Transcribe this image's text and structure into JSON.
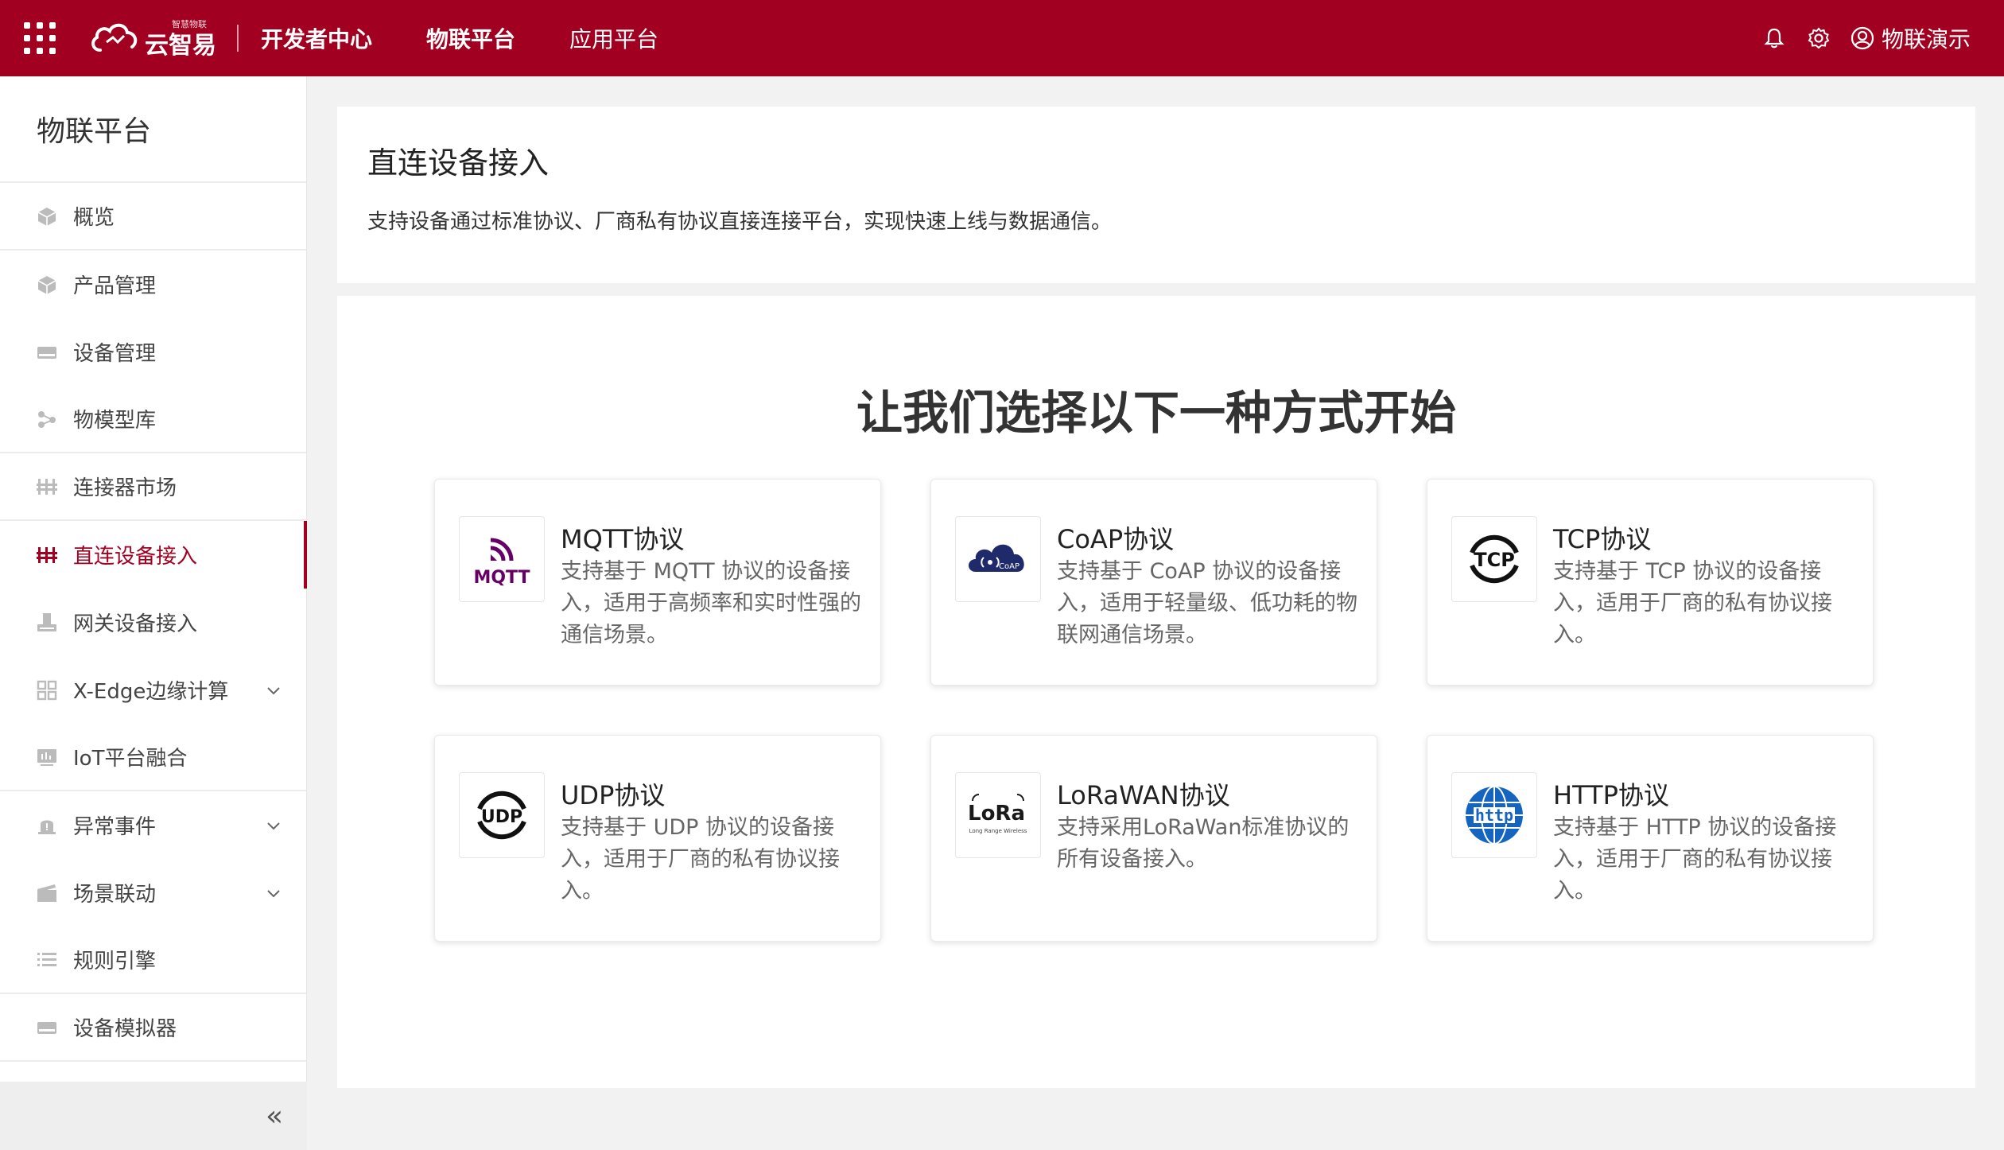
{
  "topbar": {
    "logo_small": "智慧物联",
    "logo_text": "云智易",
    "developer_center": "开发者中心",
    "nav": [
      "物联平台",
      "应用平台"
    ],
    "user_name": "物联演示",
    "icons": [
      "apps-grid-icon",
      "bell-icon",
      "gear-icon",
      "user-circle-icon"
    ]
  },
  "sidebar": {
    "title": "物联平台",
    "items": [
      {
        "label": "概览",
        "icon": "cube-icon"
      },
      {
        "label": "产品管理",
        "icon": "cube-icon"
      },
      {
        "label": "设备管理",
        "icon": "device-icon"
      },
      {
        "label": "物模型库",
        "icon": "nodes-icon"
      },
      {
        "label": "连接器市场",
        "icon": "connector-icon"
      },
      {
        "label": "直连设备接入",
        "icon": "connector-icon",
        "active": true
      },
      {
        "label": "网关设备接入",
        "icon": "gateway-icon"
      },
      {
        "label": "X-Edge边缘计算",
        "icon": "grid-icon",
        "expandable": true
      },
      {
        "label": "IoT平台融合",
        "icon": "monitor-icon"
      },
      {
        "label": "异常事件",
        "icon": "alert-icon",
        "expandable": true
      },
      {
        "label": "场景联动",
        "icon": "scene-icon",
        "expandable": true
      },
      {
        "label": "规则引擎",
        "icon": "list-icon"
      },
      {
        "label": "设备模拟器",
        "icon": "device-icon"
      }
    ],
    "collapse_label": "«"
  },
  "header": {
    "title": "直连设备接入",
    "description": "支持设备通过标准协议、厂商私有协议直接连接平台，实现快速上线与数据通信。"
  },
  "main": {
    "headline": "让我们选择以下一种方式开始",
    "protocols": [
      {
        "name": "MQTT协议",
        "description": "支持基于 MQTT 协议的设备接入，适用于高频率和实时性强的通信场景。",
        "logo_text": "MQTT",
        "color": "#660066"
      },
      {
        "name": "CoAP协议",
        "description": "支持基于 CoAP 协议的设备接入，适用于轻量级、低功耗的物联网通信场景。",
        "logo_text": "CoAP",
        "color": "#1f2a6b"
      },
      {
        "name": "TCP协议",
        "description": "支持基于 TCP 协议的设备接入，适用于厂商的私有协议接入。",
        "logo_text": "TCP",
        "color": "#111111"
      },
      {
        "name": "UDP协议",
        "description": "支持基于 UDP 协议的设备接入，适用于厂商的私有协议接入。",
        "logo_text": "UDP",
        "color": "#111111"
      },
      {
        "name": "LoRaWAN协议",
        "description": "支持采用LoRaWan标准协议的所有设备接入。",
        "logo_text": "LoRa",
        "logo_sub": "Long Range Wireless",
        "color": "#1a1a1a"
      },
      {
        "name": "HTTP协议",
        "description": "支持基于 HTTP 协议的设备接入，适用于厂商的私有协议接入。",
        "logo_text": "http",
        "color": "#1565c0"
      }
    ]
  },
  "colors": {
    "brand": "#a10020",
    "background": "#f2f2f2"
  }
}
